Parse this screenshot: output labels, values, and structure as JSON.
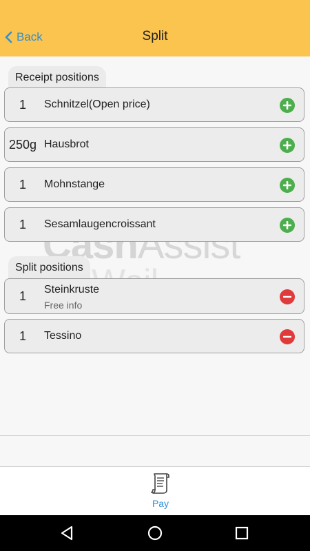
{
  "header": {
    "title": "Split",
    "back_label": "Back"
  },
  "watermark": {
    "line1_bold": "Cash",
    "line1_light": "Assist",
    "line2": "ik Weil"
  },
  "receipt": {
    "section_label": "Receipt positions",
    "items": [
      {
        "qty": "1",
        "name": "Schnitzel(Open price)"
      },
      {
        "qty": "250g",
        "name": "Hausbrot"
      },
      {
        "qty": "1",
        "name": "Mohnstange"
      },
      {
        "qty": "1",
        "name": "Sesamlaugencroissant"
      }
    ]
  },
  "split": {
    "section_label": "Split positions",
    "items": [
      {
        "qty": "1",
        "name": "Steinkruste",
        "info": "Free info"
      },
      {
        "qty": "1",
        "name": "Tessino"
      }
    ]
  },
  "footer": {
    "pay_label": "Pay"
  },
  "colors": {
    "header": "#fbc44f",
    "accent": "#2f8fd4",
    "add": "#4cae4c",
    "remove": "#e03a3a"
  },
  "icons": {
    "back": "chevron-left-icon",
    "add": "plus-circle-icon",
    "remove": "minus-circle-icon",
    "pay": "receipt-icon"
  }
}
